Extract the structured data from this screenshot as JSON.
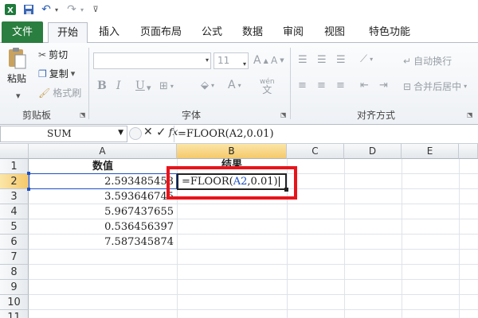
{
  "quick_access": {
    "app_icon": "excel-logo-icon",
    "save_icon": "save-icon",
    "undo_icon": "undo-icon",
    "redo_icon": "redo-icon",
    "customize_icon": "customize-dropdown-icon"
  },
  "tabs": [
    "文件",
    "开始",
    "插入",
    "页面布局",
    "公式",
    "数据",
    "审阅",
    "视图",
    "特色功能"
  ],
  "active_tab": "开始",
  "ribbon": {
    "clipboard": {
      "label": "剪贴板",
      "paste": "粘贴",
      "cut": "剪切",
      "copy": "复制",
      "format_painter": "格式刷"
    },
    "font": {
      "label": "字体",
      "font_name": "",
      "font_size": "11",
      "bold": "B",
      "italic": "I",
      "underline": "U",
      "grow": "A",
      "shrink": "A",
      "color": "A",
      "wen": "wén"
    },
    "alignment": {
      "label": "对齐方式",
      "wrap_text": "自动换行",
      "merge_center": "合并后居中"
    }
  },
  "formula_bar": {
    "name_box": "SUM",
    "cancel": "✕",
    "enter": "✓",
    "fx": "fx",
    "formula": "=FLOOR(A2,0.01)"
  },
  "grid": {
    "columns": [
      "A",
      "B",
      "C",
      "D",
      "E"
    ],
    "rows": [
      "1",
      "2",
      "3",
      "4",
      "5",
      "6",
      "7",
      "8",
      "9",
      "10",
      "11"
    ],
    "headers": {
      "a1": "数值",
      "b1": "结果"
    },
    "values": [
      "2.593485453",
      "3.593646745",
      "5.967437655",
      "0.536456397",
      "7.587345874"
    ],
    "edit_cell": {
      "prefix": "=FLOOR(",
      "ref": "A2",
      "suffix": ",0.01)"
    }
  },
  "colors": {
    "file_tab": "#2a7e3f",
    "highlight_box": "#e8141b",
    "range_ref": "#1f4fbf",
    "selected_header": "#f5c96a"
  }
}
